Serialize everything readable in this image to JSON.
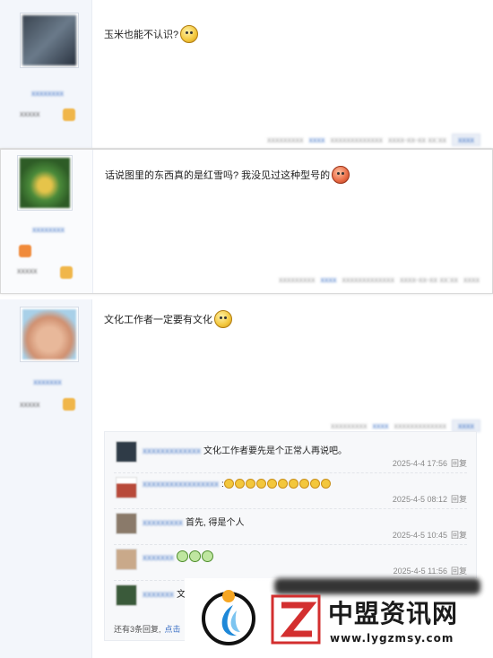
{
  "posts": [
    {
      "content": "玉米也能不认识?",
      "emoji_icon": "grimace-emoji",
      "avatar_color": "#4d5a6a"
    },
    {
      "content": "话说图里的东西真的是红雪吗? 我没见过这种型号的",
      "emoji_icon": "angry-red-emoji",
      "avatar_color": "#3f8a3a"
    },
    {
      "content": "文化工作者一定要有文化",
      "emoji_icon": "grin-emoji",
      "avatar_color": "#e0b090"
    }
  ],
  "subreplies": [
    {
      "text": "文化工作者要先是个正常人再说吧。",
      "time": "2025-4-4 17:56",
      "reply": "回复",
      "avatar_color": "#2f3b47"
    },
    {
      "text": "",
      "emoji_count": 10,
      "time": "2025-4-5 08:12",
      "reply": "回复",
      "avatar_color": "#b84a3a"
    },
    {
      "text": "首先, 得是个人",
      "time": "2025-4-5 10:45",
      "reply": "回复",
      "avatar_color": "#8a7a6a"
    },
    {
      "text": "",
      "emoji_count": 3,
      "time": "2025-4-5 11:56",
      "reply": "回复",
      "avatar_color": "#c9a98a"
    },
    {
      "text": "文",
      "time": "",
      "reply": "",
      "avatar_color": "#3a5a3a"
    }
  ],
  "more": {
    "text": "还有3条回复,",
    "link": "点击"
  },
  "watermark": {
    "brand": "中盟资讯网",
    "url": "www.lygzmsy.com"
  }
}
